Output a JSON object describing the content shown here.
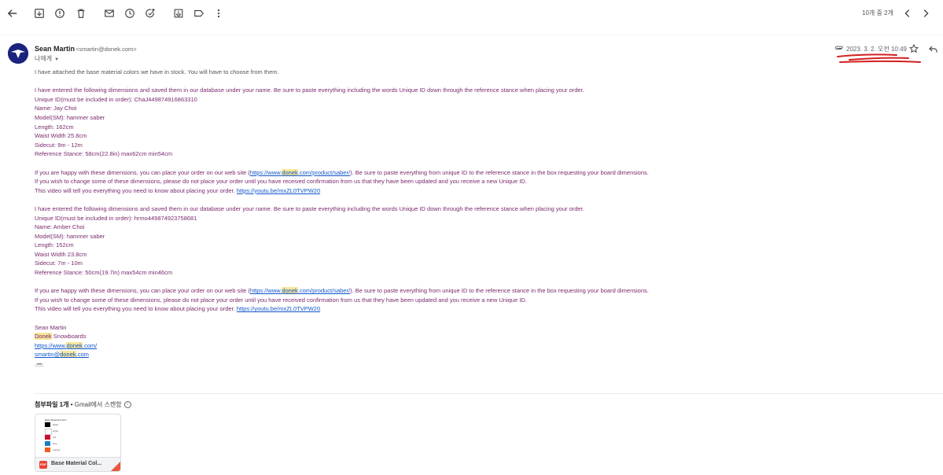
{
  "toolbar": {
    "icons": [
      "back-arrow-icon",
      "archive-icon",
      "report-spam-icon",
      "delete-icon",
      "mark-unread-icon",
      "snooze-icon",
      "add-task-icon",
      "move-to-icon",
      "label-icon",
      "more-icon"
    ],
    "pager_text": "10개 중 2개"
  },
  "email": {
    "sender_name": "Sean Martin",
    "sender_email": "<smartin@donek.com>",
    "to_label": "나에게",
    "date": "2023. 3. 2. 오전 10:49",
    "intro": "I have attached the base material colors we have in stock.  You will have to choose from them.",
    "block1": {
      "intro": "I have entered the following dimensions and saved them in our database under your name. Be sure to paste everything including the words Unique ID down through the reference stance when placing your order.",
      "unique_id": "Unique ID(must be included in order): ChaJ449874916863310",
      "name": "Name: Jay Choi",
      "model": "Model(SM): hammer saber",
      "length": "Length: 162cm",
      "waist": "Waist Width 25.8cm",
      "sidecut": "Sidecut: 9m - 12m",
      "stance": "Reference Stance: 58cm(22.8in) max62cm min54cm"
    },
    "block2": {
      "intro": "I have entered the following dimensions and saved them in our database under your name. Be sure to paste everything including the words Unique ID down through the reference stance when placing your order.",
      "unique_id": "Unique ID(must be included in order): hrmo449874923758681",
      "name": "Name: Amber Choi",
      "model": "Model(SM): hammer saber",
      "length": "Length: 152cm",
      "waist": "Waist Width 23.8cm",
      "sidecut": "Sidecut: 7m - 10m",
      "stance": "Reference Stance: 50cm(19.7in) max54cm min46cm"
    },
    "order": {
      "happy_pre": "If you are happy with these dimensions, you can place your order on our web site (",
      "link_pre": "https://www.",
      "link_hl": "donek",
      "link_post": ".com/product/saber/",
      "happy_post": "). Be sure to paste everything from unique ID to the reference stance in the box requesting your board dimensions.",
      "change": "If you wish to change some of these dimensions, please do not place your order until you have received confirmation from us that they have been updated and you receive a new Unique ID.",
      "video_text": "This video will tell you everything you need to know about placing your order.  ",
      "video_link": "https://youtu.be/mxZL0TVPW20"
    },
    "signature": {
      "name": "Sean Martin",
      "company_hl": "Donek",
      "company_rest": " Snowboards",
      "url_pre": "https://www.",
      "url_hl": "donek",
      "url_post": ".com/",
      "email_pre": "smartin@",
      "email_hl": "donek",
      "email_post": ".com"
    },
    "ellipsis": "•••"
  },
  "attachments": {
    "header_title": "첨부파일 1개",
    "bullet": " • ",
    "scan_text": "Gmail에서 스캔함",
    "info_glyph": "i",
    "file_name": "Base Material Col...",
    "file_type": "PDF",
    "thumb_title": "Base Material Colors",
    "swatches": [
      {
        "color": "#000000",
        "label": "black"
      },
      {
        "color": "#ffffff",
        "label": "white"
      },
      {
        "color": "#c8102e",
        "label": "red"
      },
      {
        "color": "#1a7fc1",
        "label": "blue"
      },
      {
        "color": "#f25c19",
        "label": "orange"
      }
    ]
  },
  "colors": {
    "body_text": "#7a2a6e",
    "link": "#1155cc",
    "highlight": "#f7e79a",
    "avatar": "#1a237e",
    "scribble": "#d21f1f"
  }
}
